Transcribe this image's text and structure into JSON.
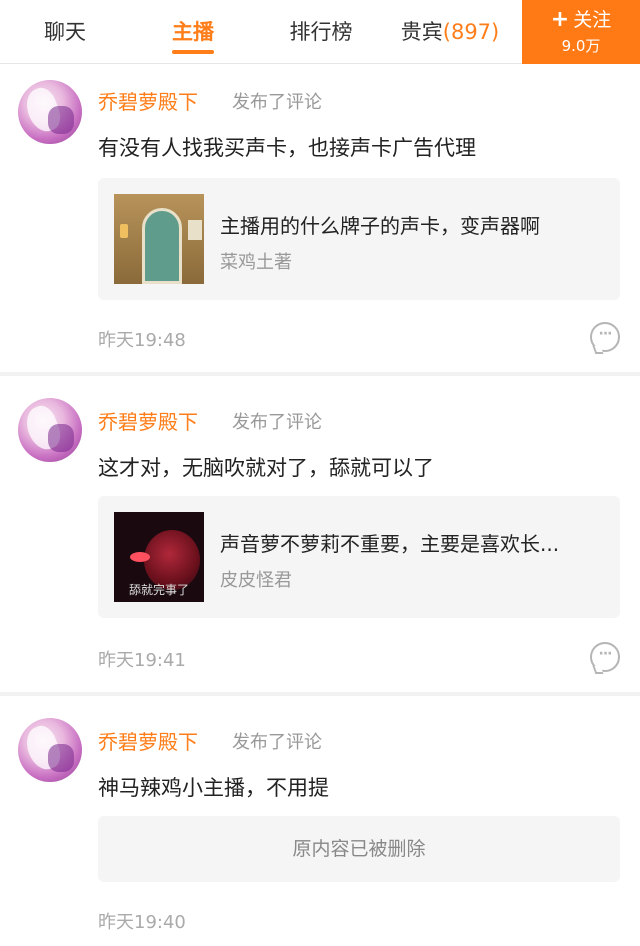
{
  "tabs": {
    "chat": "聊天",
    "host": "主播",
    "rank": "排行榜",
    "vip": "贵宾",
    "vip_count": "(897)"
  },
  "follow": {
    "label": "关注",
    "count": "9.0万"
  },
  "posts": [
    {
      "user": "乔碧萝殿下",
      "action": "发布了评论",
      "content": "有没有人找我买声卡，也接声卡广告代理",
      "quote": {
        "text": "主播用的什么牌子的声卡，变声器啊",
        "author": "菜鸡土著",
        "thumb_caption": ""
      },
      "time": "昨天19:48"
    },
    {
      "user": "乔碧萝殿下",
      "action": "发布了评论",
      "content": "这才对，无脑吹就对了，舔就可以了",
      "quote": {
        "text": "声音萝不萝莉不重要，主要是喜欢长...",
        "author": "皮皮怪君",
        "thumb_caption": "舔就完事了"
      },
      "time": "昨天19:41"
    },
    {
      "user": "乔碧萝殿下",
      "action": "发布了评论",
      "content": "神马辣鸡小主播，不用提",
      "deleted_text": "原内容已被删除",
      "time": "昨天19:40"
    }
  ],
  "colors": {
    "accent": "#ff7e1a",
    "follow_bg": "#ff7a14",
    "quote_bg": "#f5f5f5"
  }
}
